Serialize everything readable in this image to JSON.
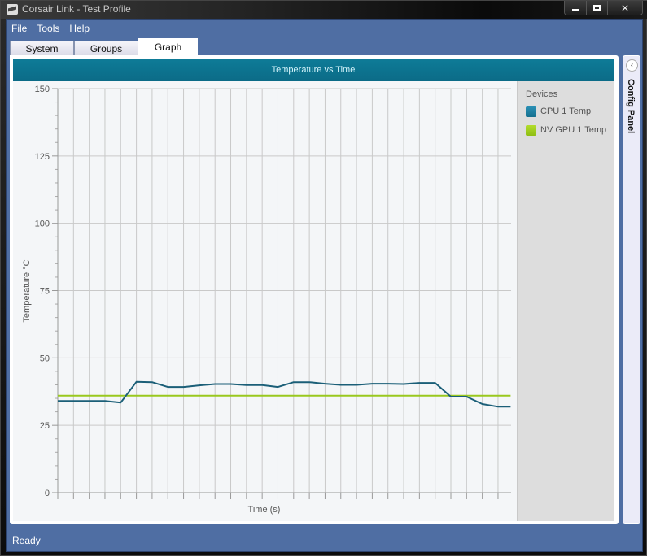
{
  "window": {
    "title": "Corsair Link - Test Profile",
    "icon": "corsair-logo-icon",
    "controls": {
      "minimize": "minimize-icon",
      "maximize": "maximize-icon",
      "close": "close-icon",
      "close_glyph": "✕"
    }
  },
  "menubar": {
    "items": [
      {
        "label": "File"
      },
      {
        "label": "Tools"
      },
      {
        "label": "Help"
      }
    ]
  },
  "tabs": [
    {
      "label": "System",
      "selected": false
    },
    {
      "label": "Groups",
      "selected": false
    },
    {
      "label": "Graph",
      "selected": true
    }
  ],
  "legend": {
    "title": "Devices",
    "items": [
      {
        "label": "CPU 1 Temp",
        "color": "#1a7a9c"
      },
      {
        "label": "NV GPU 1 Temp",
        "color": "#99c81e"
      }
    ]
  },
  "config_panel": {
    "label": "Config Panel",
    "toggle_glyph": "‹"
  },
  "status": {
    "text": "Ready"
  },
  "colors": {
    "header": "#0e7c98",
    "cpu_line": "#1b5f78",
    "gpu_line": "#99c81e",
    "chrome": "#4f6ea3"
  },
  "chart_data": {
    "type": "line",
    "title": "Temperature vs Time",
    "xlabel": "Time (s)",
    "ylabel": "Temperature °C",
    "ylim": [
      0,
      150
    ],
    "yticks": [
      0,
      25,
      50,
      75,
      100,
      125,
      150
    ],
    "ytick_labels": [
      "0",
      "25",
      "50",
      "75",
      "100",
      "125",
      "150"
    ],
    "y_minor_step": 5,
    "x_tick_count": 29,
    "x_tick_labels_shown": false,
    "grid": {
      "vertical": true,
      "horizontal_major": true
    },
    "legend_position": "right",
    "x": [
      0,
      1,
      2,
      3,
      4,
      5,
      6,
      7,
      8,
      9,
      10,
      11,
      12,
      13,
      14,
      15,
      16,
      17,
      18,
      19,
      20,
      21,
      22,
      23,
      24,
      25,
      26,
      27,
      28,
      28.8
    ],
    "series": [
      {
        "name": "CPU 1 Temp",
        "values": [
          34,
          34,
          34,
          34,
          33.4,
          41.1,
          41,
          39.2,
          39.2,
          39.8,
          40.3,
          40.3,
          39.9,
          39.9,
          39.2,
          41,
          41,
          40.4,
          40,
          40,
          40.4,
          40.4,
          40.3,
          40.7,
          40.7,
          35.6,
          35.6,
          32.9,
          31.9,
          31.9
        ]
      },
      {
        "name": "NV GPU 1 Temp",
        "values": [
          36,
          36,
          36,
          36,
          36,
          36,
          36,
          36,
          36,
          36,
          36,
          36,
          36,
          36,
          36,
          36,
          36,
          36,
          36,
          36,
          36,
          36,
          36,
          36,
          36,
          36,
          36,
          36,
          36,
          36
        ]
      }
    ]
  }
}
